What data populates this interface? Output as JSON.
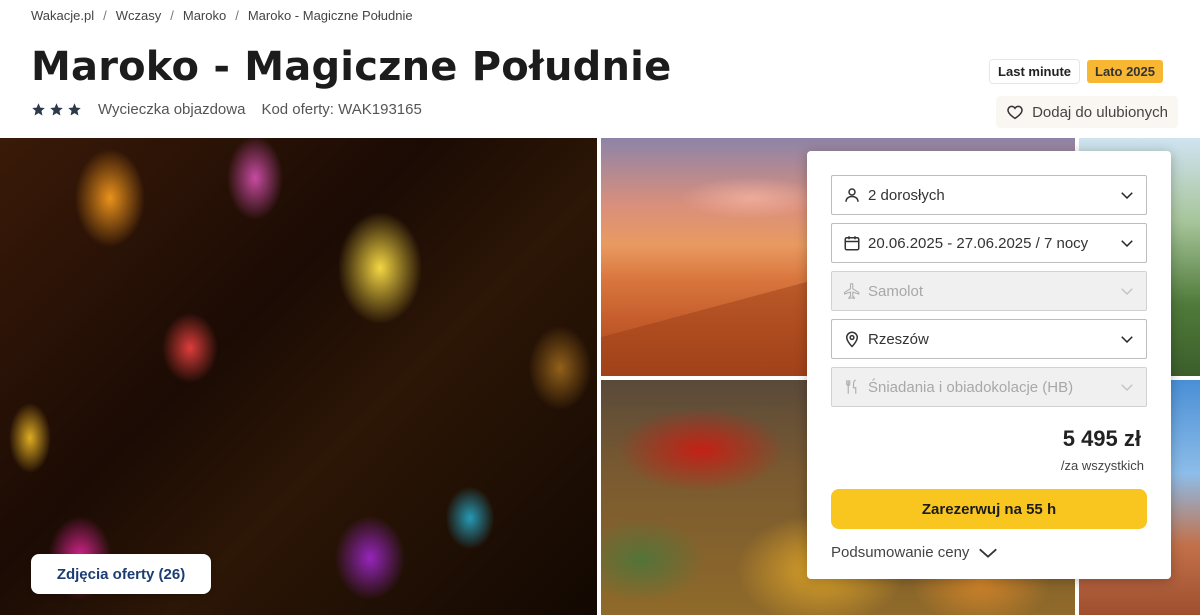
{
  "breadcrumb": [
    "Wakacje.pl",
    "Wczasy",
    "Maroko",
    "Maroko - Magiczne Południe"
  ],
  "title": "Maroko - Magiczne Południe",
  "meta": {
    "stars": 3,
    "trip_type": "Wycieczka objazdowa",
    "offer_code": "Kod oferty: WAK193165"
  },
  "badges": {
    "last_minute": "Last minute",
    "season": "Lato 2025"
  },
  "favorite_label": "Dodaj do ulubionych",
  "photos_button": "Zdjęcia oferty (26)",
  "booking": {
    "travelers": "2 dorosłych",
    "dates": "20.06.2025 - 27.06.2025 / 7 nocy",
    "transport": "Samolot",
    "departure": "Rzeszów",
    "board": "Śniadania i obiadokolacje (HB)",
    "price": "5 495 zł",
    "price_note": "/za wszystkich",
    "book_button": "Zarezerwuj na 55 h",
    "summary_label": "Podsumowanie ceny"
  },
  "colors": {
    "accent_yellow": "#f9c620",
    "season_badge": "#f7b733",
    "link_blue": "#1c3d73"
  }
}
